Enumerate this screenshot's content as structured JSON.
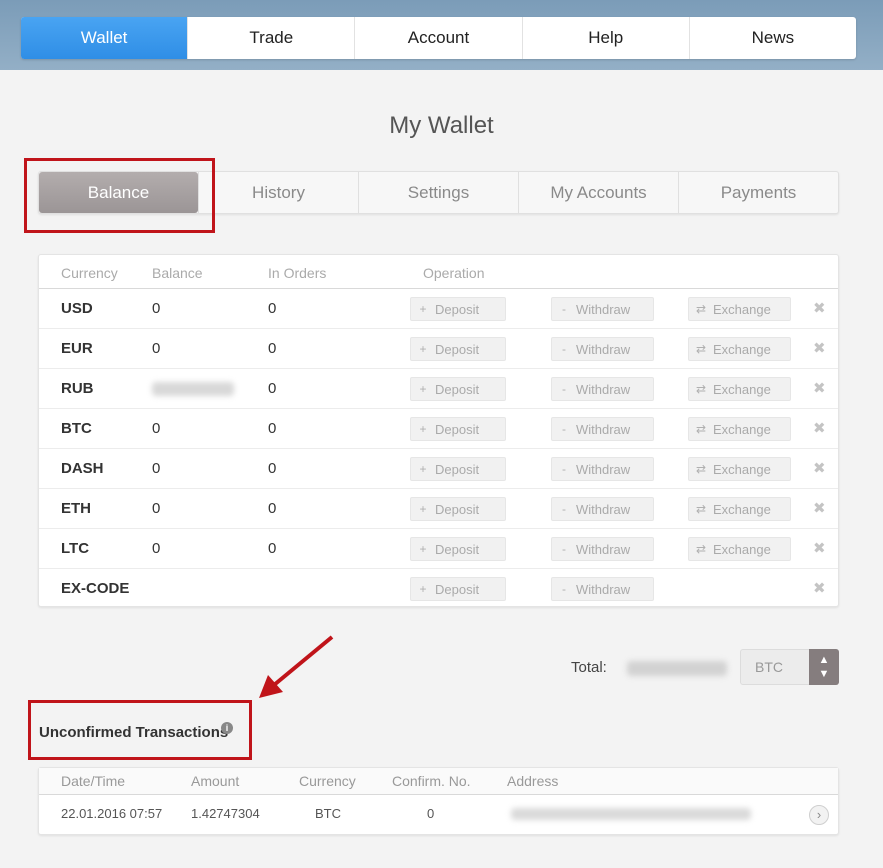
{
  "nav": {
    "items": [
      {
        "label": "Wallet",
        "active": true
      },
      {
        "label": "Trade",
        "active": false
      },
      {
        "label": "Account",
        "active": false
      },
      {
        "label": "Help",
        "active": false
      },
      {
        "label": "News",
        "active": false
      }
    ]
  },
  "page": {
    "title": "My Wallet"
  },
  "tabs": [
    {
      "label": "Balance",
      "active": true
    },
    {
      "label": "History",
      "active": false
    },
    {
      "label": "Settings",
      "active": false
    },
    {
      "label": "My Accounts",
      "active": false
    },
    {
      "label": "Payments",
      "active": false
    }
  ],
  "balances": {
    "headers": {
      "currency": "Currency",
      "balance": "Balance",
      "in_orders": "In Orders",
      "operation": "Operation"
    },
    "actions": {
      "deposit": "Deposit",
      "withdraw": "Withdraw",
      "exchange": "Exchange",
      "deposit_icon": "plus-icon",
      "withdraw_icon": "minus-icon",
      "exchange_icon": "exchange-arrows-icon",
      "remove_icon": "close-x-icon"
    },
    "rows": [
      {
        "currency": "USD",
        "balance": "0",
        "in_orders": "0",
        "exchange": true
      },
      {
        "currency": "EUR",
        "balance": "0",
        "in_orders": "0",
        "exchange": true
      },
      {
        "currency": "RUB",
        "balance": null,
        "balance_obscured": true,
        "in_orders": "0",
        "exchange": true
      },
      {
        "currency": "BTC",
        "balance": "0",
        "in_orders": "0",
        "exchange": true
      },
      {
        "currency": "DASH",
        "balance": "0",
        "in_orders": "0",
        "exchange": true
      },
      {
        "currency": "ETH",
        "balance": "0",
        "in_orders": "0",
        "exchange": true
      },
      {
        "currency": "LTC",
        "balance": "0",
        "in_orders": "0",
        "exchange": true
      },
      {
        "currency": "EX-CODE",
        "balance": "",
        "in_orders": "",
        "exchange": false
      }
    ]
  },
  "total": {
    "label": "Total:",
    "value_obscured": true,
    "currency": "BTC"
  },
  "unconfirmed": {
    "title": "Unconfirmed Transactions",
    "info_icon": "info-icon",
    "headers": {
      "datetime": "Date/Time",
      "amount": "Amount",
      "currency": "Currency",
      "confirmations": "Confirm. No.",
      "address": "Address"
    },
    "rows": [
      {
        "datetime": "22.01.2016 07:57",
        "amount": "1.42747304",
        "currency": "BTC",
        "confirmations": "0",
        "address_obscured": true
      }
    ]
  },
  "colors": {
    "nav_active": "#2f8ee6",
    "tab_active": "#9b9596",
    "annotation_red": "#c0141a",
    "topbar": "#8aa7c0"
  }
}
